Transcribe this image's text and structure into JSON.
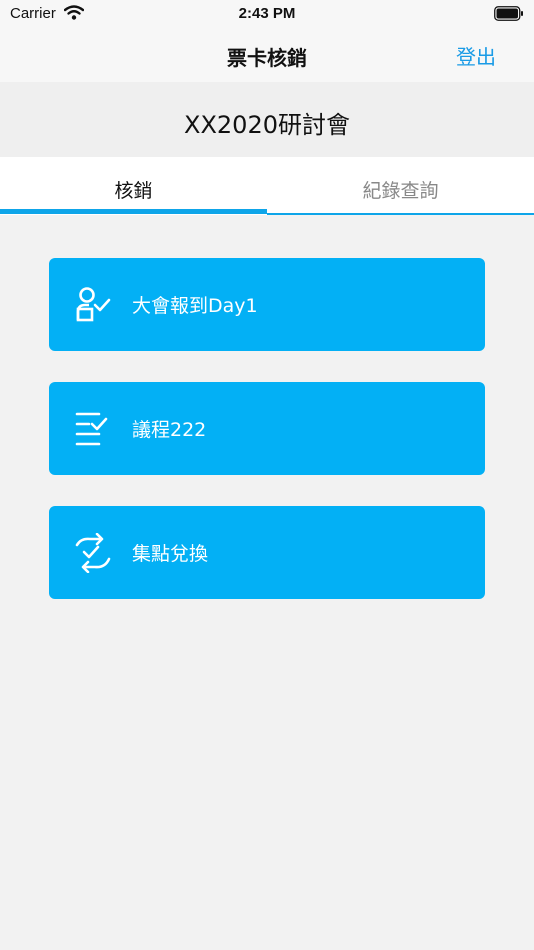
{
  "status_bar": {
    "carrier": "Carrier",
    "time": "2:43 PM"
  },
  "nav": {
    "title": "票卡核銷",
    "logout_label": "登出"
  },
  "event": {
    "title": "XX2020研討會"
  },
  "tabs": [
    {
      "label": "核銷",
      "active": true
    },
    {
      "label": "紀錄查詢",
      "active": false
    }
  ],
  "actions": [
    {
      "label": "大會報到Day1",
      "icon": "user-check-icon"
    },
    {
      "label": "議程222",
      "icon": "list-check-icon"
    },
    {
      "label": "集點兌換",
      "icon": "exchange-check-icon"
    }
  ],
  "colors": {
    "accent": "#03b0f5",
    "link": "#1a9be6",
    "underline": "#0ea5e9"
  }
}
